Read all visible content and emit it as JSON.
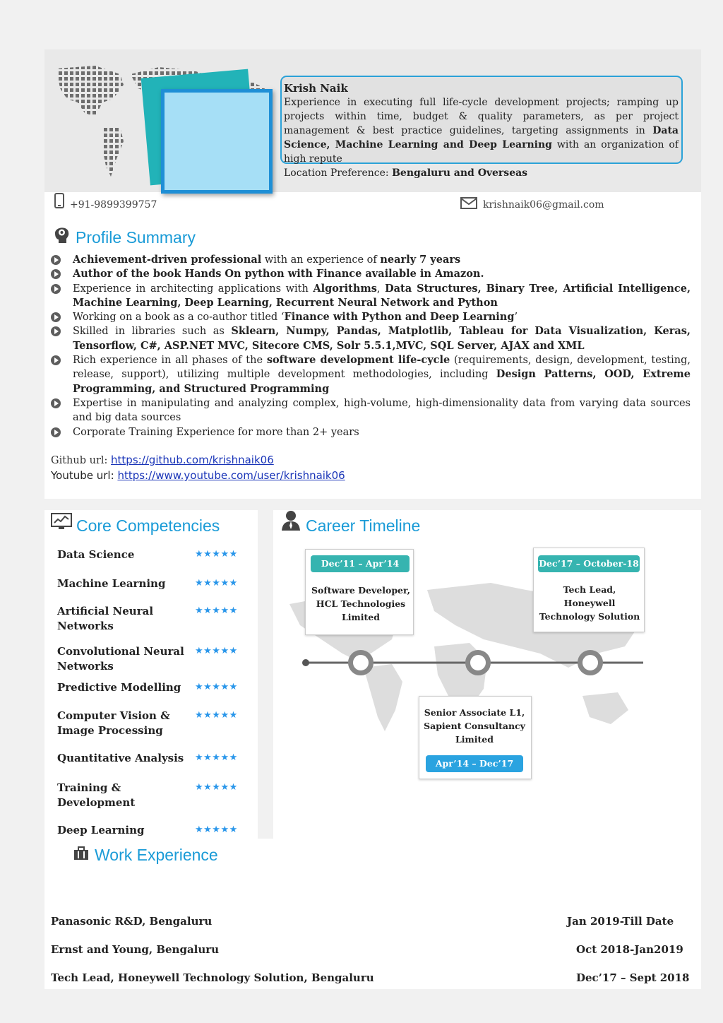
{
  "header": {
    "name": "Krish Naik",
    "bio_parts": [
      "Experience in executing full life-cycle development projects; ramping up projects within time, budget & quality parameters, as per project management & best practice guidelines, targeting assignments in ",
      "Data Science, Machine Learning and Deep Learning",
      " with an organization of high repute"
    ],
    "location_label": "Location Preference: ",
    "location_value": "Bengaluru and Overseas"
  },
  "contact": {
    "phone": "+91-9899399757",
    "email": "krishnaik06@gmail.com"
  },
  "profile_summary": {
    "title": "Profile Summary",
    "items": [
      {
        "parts": [
          {
            "t": "Achievement-driven professional",
            "b": true
          },
          {
            "t": " with an experience of ",
            "b": false
          },
          {
            "t": "nearly 7 years",
            "b": true
          }
        ]
      },
      {
        "parts": [
          {
            "t": "Author of the book Hands On python with Finance available in Amazon.",
            "b": true
          }
        ]
      },
      {
        "parts": [
          {
            "t": "Experience in architecting applications with ",
            "b": false
          },
          {
            "t": "Algorithms",
            "b": true
          },
          {
            "t": ", ",
            "b": false
          },
          {
            "t": "Data Structures, Binary Tree, Artificial Intelligence, Machine Learning, Deep Learning, Recurrent Neural Network and Python",
            "b": true
          }
        ]
      },
      {
        "parts": [
          {
            "t": "Working on a book as a co-author titled ‘",
            "b": false
          },
          {
            "t": "Finance with Python and Deep Learning",
            "b": true
          },
          {
            "t": "’",
            "b": false
          }
        ]
      },
      {
        "parts": [
          {
            "t": "Skilled in libraries such as ",
            "b": false
          },
          {
            "t": "Sklearn, Numpy, Pandas, Matplotlib, Tableau for Data Visualization, Keras, Tensorflow, C#, ASP.NET MVC, Sitecore CMS, Solr 5.5.1,MVC, SQL Server, AJAX and XML",
            "b": true
          }
        ]
      },
      {
        "parts": [
          {
            "t": "Rich experience in all phases of the ",
            "b": false
          },
          {
            "t": "software development life-cycle",
            "b": true
          },
          {
            "t": " (requirements, design, development, testing, release, support), utilizing multiple development methodologies, including ",
            "b": false
          },
          {
            "t": "Design Patterns, OOD, Extreme Programming, and Structured Programming",
            "b": true
          }
        ]
      },
      {
        "parts": [
          {
            "t": "Expertise in manipulating and analyzing complex, high-volume, high-dimensionality data from varying data sources and big data sources",
            "b": false
          }
        ]
      },
      {
        "parts": [
          {
            "t": "Corporate Training Experience for more than 2+ years",
            "b": false
          }
        ]
      }
    ]
  },
  "links": {
    "github_label": "Github url: ",
    "github_url": "https://github.com/krishnaik06",
    "youtube_label": "Youtube url: ",
    "youtube_url": "https://www.youtube.com/user/krishnaik06"
  },
  "core_competencies": {
    "title": "Core Competencies",
    "items": [
      {
        "label": "Data Science",
        "stars": "★★★★★",
        "rating": 5
      },
      {
        "label": "Machine Learning",
        "stars": "★★★★★",
        "rating": 5
      },
      {
        "label": "Artificial Neural Networks",
        "stars": "★★★★★",
        "rating": 5
      },
      {
        "label": "Convolutional Neural Networks",
        "stars": "★★★★★",
        "rating": 5
      },
      {
        "label": "Predictive Modelling",
        "stars": "★★★★★",
        "rating": 5
      },
      {
        "label": "Computer Vision & Image Processing",
        "stars": "★★★★★",
        "rating": 5
      },
      {
        "label": "Quantitative Analysis",
        "stars": "★★★★★",
        "rating": 5
      },
      {
        "label": "Training & Development",
        "stars": "★★★★★",
        "rating": 5
      },
      {
        "label": "Deep Learning",
        "stars": "★★★★★",
        "rating": 5
      }
    ]
  },
  "career_timeline": {
    "title": "Career Timeline",
    "entries": [
      {
        "dates": "Dec’11 – Apr’14",
        "role_lines": [
          "Software Developer,",
          "HCL Technologies",
          "Limited"
        ]
      },
      {
        "dates": "Apr’14 – Dec’17",
        "role_lines": [
          "Senior Associate L1,",
          "Sapient Consultancy",
          "Limited"
        ]
      },
      {
        "dates": "Dec’17 – October-18",
        "role_lines": [
          "Tech Lead,",
          "Honeywell",
          "Technology Solution"
        ]
      }
    ]
  },
  "work_experience": {
    "title": "Work Experience",
    "rows": [
      {
        "company": "Panasonic R&D, Bengaluru",
        "period": "Jan 2019-Till Date"
      },
      {
        "company": "Ernst and Young, Bengaluru",
        "period": "Oct 2018-Jan2019"
      },
      {
        "company": "Tech Lead, Honeywell Technology Solution, Bengaluru",
        "period": "Dec’17 – Sept 2018"
      }
    ]
  },
  "colors": {
    "accent": "#1a9bd7",
    "teal": "#36b4b0",
    "star": "#2996ea"
  },
  "icons": [
    "phone-icon",
    "mail-icon",
    "head-gear-icon",
    "monitor-chart-icon",
    "person-tie-icon",
    "briefcase-icon",
    "bullet-play-icon",
    "star-icon"
  ]
}
